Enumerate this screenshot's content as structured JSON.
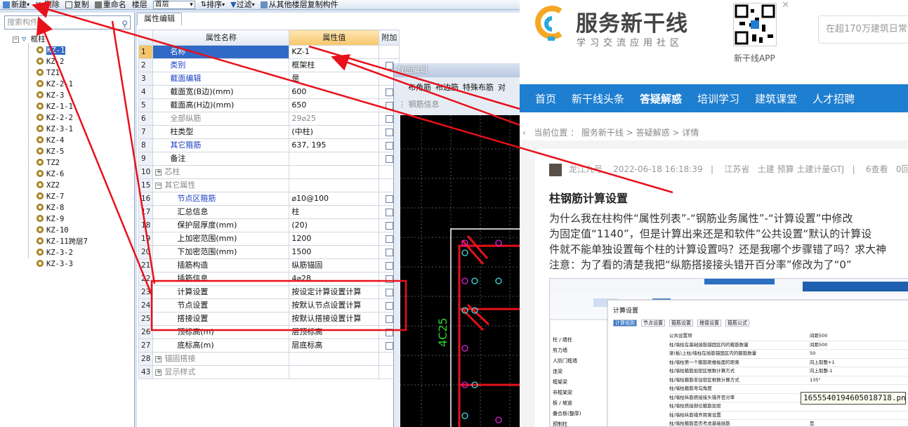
{
  "toolbar": {
    "new": "新建",
    "delete": "删除",
    "copy": "复制",
    "rename": "重命名",
    "floor_label": "楼层",
    "floor_value": "首层",
    "sort": "排序",
    "filter": "过滤",
    "copy_from": "从其他楼层复制构件"
  },
  "tree": {
    "search_placeholder": "搜索构件...",
    "root": "框柱",
    "items": [
      "KZ-1",
      "KZ-2",
      "TZ1",
      "KZ-2-1",
      "KZ-3",
      "KZ-1-1",
      "KZ-2-2",
      "KZ-3-1",
      "KZ-4",
      "KZ-5",
      "TZ2",
      "KZ-6",
      "XZ2",
      "KZ-7",
      "KZ-8",
      "KZ-9",
      "KZ-10",
      "KZ-11跨层7",
      "KZ-3-2",
      "KZ-3-3"
    ],
    "selected": "KZ-1"
  },
  "props": {
    "tab": "属性编辑",
    "headers": {
      "name": "属性名称",
      "value": "属性值",
      "extra": "附加"
    },
    "rows": [
      {
        "no": "1",
        "name": "名称",
        "value": "KZ-1"
      },
      {
        "no": "2",
        "name": "类别",
        "value": "框架柱"
      },
      {
        "no": "3",
        "name": "截面编辑",
        "value": "是"
      },
      {
        "no": "4",
        "name": "截面宽(B边)(mm)",
        "value": "600"
      },
      {
        "no": "5",
        "name": "截面高(H边)(mm)",
        "value": "650"
      },
      {
        "no": "6",
        "name": "全部纵筋",
        "value": "29⌀25"
      },
      {
        "no": "7",
        "name": "柱类型",
        "value": "(中柱)"
      },
      {
        "no": "8",
        "name": "其它箍筋",
        "value": "637, 195"
      },
      {
        "no": "9",
        "name": "备注",
        "value": ""
      },
      {
        "no": "10",
        "name": "芯柱",
        "value": ""
      },
      {
        "no": "15",
        "name": "其它属性",
        "value": ""
      },
      {
        "no": "16",
        "name": "节点区箍筋",
        "value": "⌀10@100"
      },
      {
        "no": "17",
        "name": "汇总信息",
        "value": "柱"
      },
      {
        "no": "18",
        "name": "保护层厚度(mm)",
        "value": "(20)"
      },
      {
        "no": "19",
        "name": "上加密范围(mm)",
        "value": "1200"
      },
      {
        "no": "20",
        "name": "下加密范围(mm)",
        "value": "1500"
      },
      {
        "no": "21",
        "name": "插筋构造",
        "value": "纵筋锚固"
      },
      {
        "no": "22",
        "name": "插筋信息",
        "value": "4⌀28"
      },
      {
        "no": "23",
        "name": "计算设置",
        "value": "按设定计算设置计算"
      },
      {
        "no": "24",
        "name": "节点设置",
        "value": "按默认节点设置计算"
      },
      {
        "no": "25",
        "name": "搭接设置",
        "value": "按默认搭接设置计算"
      },
      {
        "no": "26",
        "name": "顶标高(m)",
        "value": "层顶标高"
      },
      {
        "no": "27",
        "name": "底标高(m)",
        "value": "层底标高"
      },
      {
        "no": "28",
        "name": "锚固搭接",
        "value": ""
      },
      {
        "no": "43",
        "name": "显示样式",
        "value": ""
      }
    ]
  },
  "section": {
    "title": "截面编辑",
    "tabs": [
      "布角筋",
      "布边筋",
      "特殊布筋",
      "对"
    ],
    "sub": "钢筋信息",
    "label": "4C25"
  },
  "web": {
    "logo": "服务新干线",
    "logo_sub": "学习交流应用社区",
    "qr_label": "新干线APP",
    "search_placeholder": "在超170万建筑日常",
    "nav": [
      "首页",
      "新干线头条",
      "答疑解惑",
      "培训学习",
      "建筑课堂",
      "人才招聘"
    ],
    "nav_active": "答疑解惑",
    "breadcrumb": "当前位置 ： 服务新干线 > 答疑解惑 > 详情",
    "author": "龙江九号",
    "date": "2022-06-18 16:18:39",
    "region": "江苏省",
    "tags": "土建 预算 土建计量GTJ",
    "views": "6查看",
    "answers": "0回",
    "title": "柱钢筋计算设置",
    "body": [
      "为什么我在柱构件“属性列表”-“钢筋业务属性”-“计算设置”中修改",
      "为固定值“1140”，但是计算出来还是和软件”公共设置“默认的计算设",
      "件就不能单独设置每个柱的计算设置吗？还是我哪个步骤错了吗？求大神",
      "注意：为了看的清楚我把“纵筋搭接接头错开百分率”修改为了“0”"
    ],
    "filename": "1655540194605018718.png",
    "shot": {
      "title": "计算设置",
      "tabs": [
        "计算规则",
        "节点设置",
        "箍筋设置",
        "搭接设置",
        "箍筋公式"
      ],
      "side": [
        "柱 / 墙柱",
        "剪力墙",
        "人防门框墙",
        "连梁",
        "框架梁",
        "非框架梁",
        "板 / 坡道",
        "叠合板(整厚)",
        "预制柱"
      ],
      "rows": [
        "公共设置项",
        "柱/墙柱在基础插筋锚固区内的箍筋数量",
        "梁(板)上柱/墙柱在插筋锚固区内的箍筋数量",
        "柱/墙柱第一个箍筋距楼板面的距离",
        "柱/墙柱箍筋加密区根数计算方式",
        "柱/墙柱箍筋非加密区根数计算方式",
        "柱/墙柱箍筋弯勾角度",
        "柱/墙柱纵筋搭接接头错开百分率",
        "柱/墙柱搭接部位箍筋加密",
        "柱/墙柱纵筋错开距离设置",
        "柱/墙柱箍筋是否考虑基础插筋"
      ],
      "vals": [
        "间距500",
        "间距500",
        "50",
        "向上取整+1",
        "向上取整-1",
        "135°",
        "",
        "",
        "",
        "",
        "是"
      ]
    }
  },
  "colors": {
    "accent": "#1e7ed0",
    "annotation": "#e8101a",
    "select": "#3169c6"
  }
}
